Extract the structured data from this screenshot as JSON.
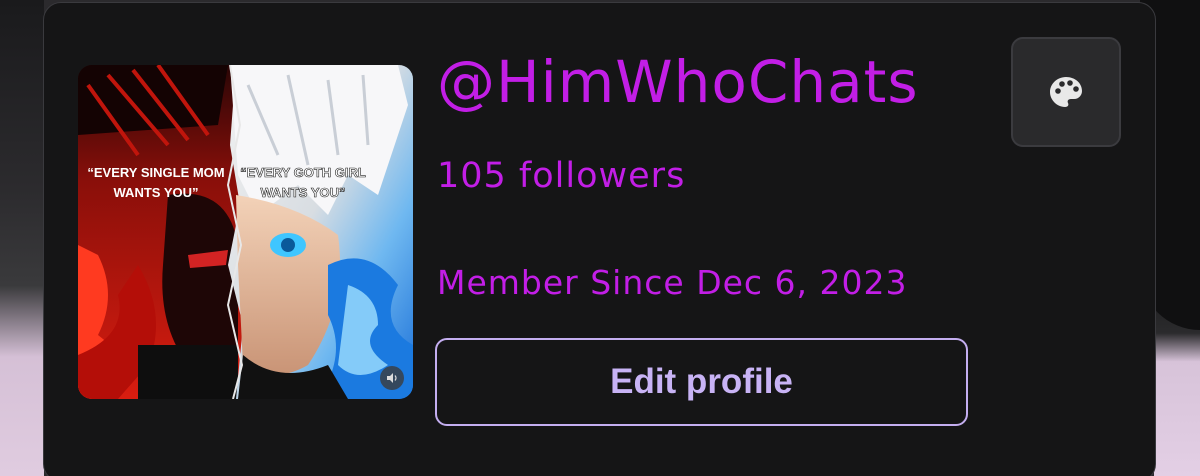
{
  "profile": {
    "username": "@HimWhoChats",
    "followers": "105 followers",
    "member_since": "Member Since Dec 6, 2023",
    "edit_label": "Edit profile"
  },
  "avatar": {
    "caption_left_1": "“EVERY SINGLE MOM",
    "caption_left_2": "WANTS YOU”",
    "caption_right_1": "“EVERY GOTH GIRL",
    "caption_right_2": "WANTS YOU”"
  },
  "icons": {
    "theme": "palette-icon",
    "sound": "speaker-icon"
  },
  "colors": {
    "accent": "#c21ee6",
    "button_text": "#c8b3f5",
    "card_bg": "#151516"
  }
}
